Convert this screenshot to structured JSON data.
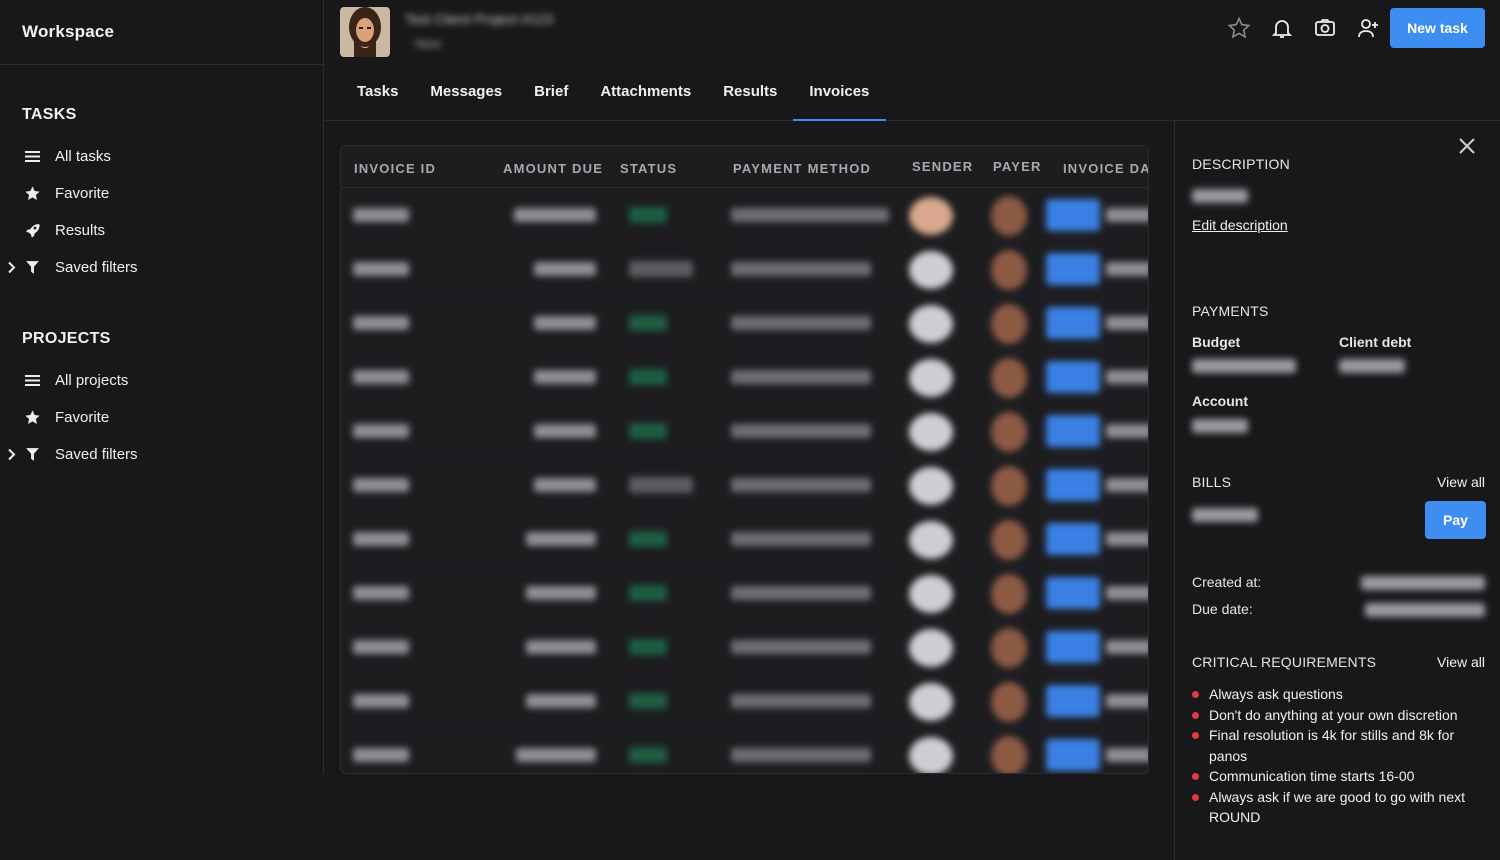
{
  "app": {
    "title": "Workspace"
  },
  "sidebar": {
    "tasks_heading": "TASKS",
    "tasks_items": [
      {
        "label": "All tasks",
        "icon": "list-icon"
      },
      {
        "label": "Favorite",
        "icon": "star-icon"
      },
      {
        "label": "Results",
        "icon": "rocket-icon"
      },
      {
        "label": "Saved filters",
        "icon": "filter-icon",
        "expandable": true
      }
    ],
    "projects_heading": "PROJECTS",
    "projects_items": [
      {
        "label": "All projects",
        "icon": "list-icon"
      },
      {
        "label": "Favorite",
        "icon": "star-icon"
      },
      {
        "label": "Saved filters",
        "icon": "filter-icon",
        "expandable": true
      }
    ]
  },
  "header": {
    "project_title": "Test Client Project #123",
    "project_subtitle": "New",
    "new_task_label": "New task",
    "icons": [
      "star-icon",
      "bell-icon",
      "camera-icon",
      "add-user-icon"
    ]
  },
  "tabs": [
    {
      "label": "Tasks",
      "active": false
    },
    {
      "label": "Messages",
      "active": false
    },
    {
      "label": "Brief",
      "active": false
    },
    {
      "label": "Attachments",
      "active": false
    },
    {
      "label": "Results",
      "active": false
    },
    {
      "label": "Invoices",
      "active": true
    }
  ],
  "invoices_table": {
    "columns": [
      "INVOICE ID",
      "AMOUNT DUE",
      "STATUS",
      "PAYMENT METHOD",
      "SENDER",
      "PAYER",
      "INVOICE DAT"
    ]
  },
  "details_panel": {
    "description_heading": "DESCRIPTION",
    "edit_description_label": "Edit description",
    "payments_heading": "PAYMENTS",
    "budget_label": "Budget",
    "client_debt_label": "Client debt",
    "account_label": "Account",
    "bills_heading": "BILLS",
    "bills_view_all": "View all",
    "pay_label": "Pay",
    "created_at_label": "Created at:",
    "due_date_label": "Due date:",
    "critical_heading": "CRITICAL REQUIREMENTS",
    "critical_view_all": "View all",
    "requirements": [
      "Always ask questions",
      "Don't do anything at your own discretion",
      "Final resolution is 4k for stills and 8k for panos",
      "Communication time starts 16-00",
      "Always ask if we are good to go with next ROUND"
    ]
  },
  "colors": {
    "accent": "#3d8ef0",
    "background": "#18181a",
    "status_paid": "#1f5e43",
    "bullet": "#e03c3c"
  }
}
